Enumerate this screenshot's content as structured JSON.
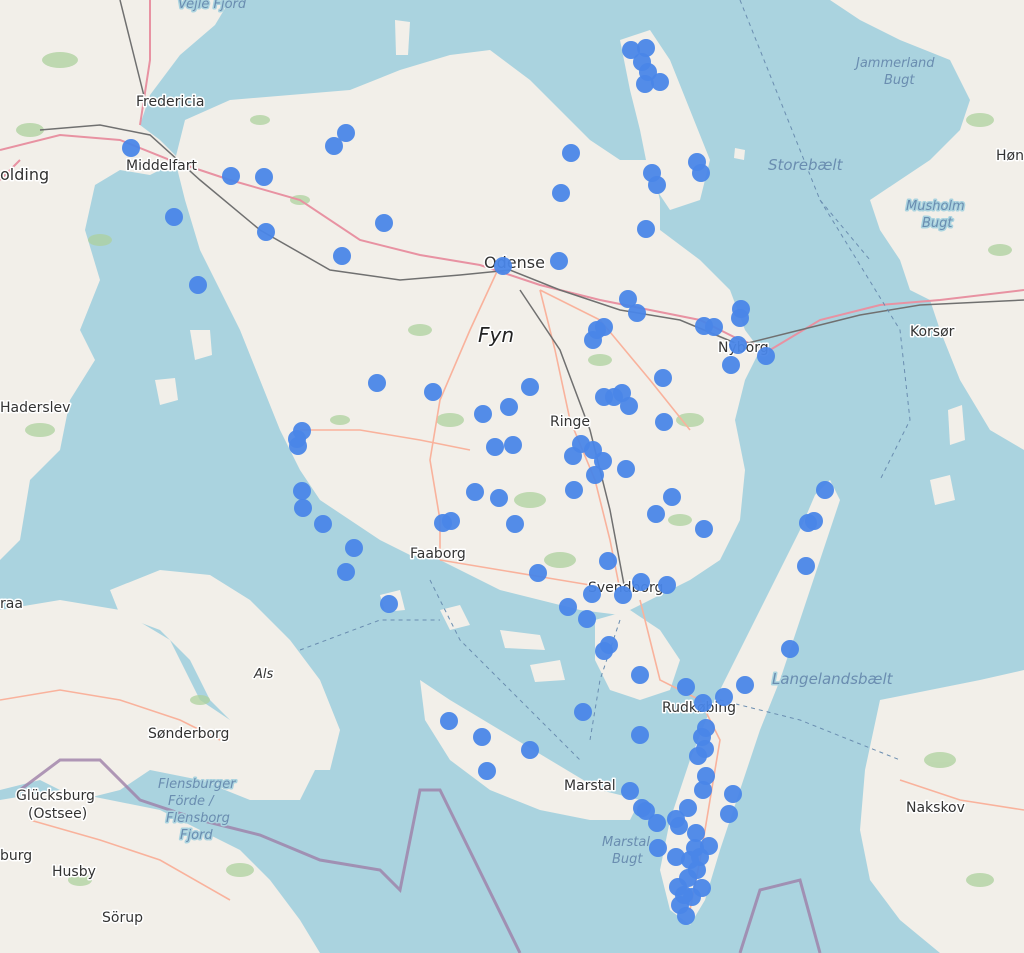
{
  "colors": {
    "sea": "#aad3df",
    "land": "#f2efe9",
    "forest": "#add19e",
    "road_primary": "#e892a2",
    "road_secondary": "#f9b29c",
    "rail": "#707070",
    "border": "#9e7fa8",
    "marker": "#4a86e8"
  },
  "labels": {
    "vejle_fjord": "Vejle Fjord",
    "fredericia": "Fredericia",
    "middelfart": "Middelfart",
    "kolding": "olding",
    "haderslev": "Haderslev",
    "odense": "Odense",
    "fyn": "Fyn",
    "ringe": "Ringe",
    "faaborg": "Faaborg",
    "svendborg": "Svendborg",
    "nyborg": "Nyborg",
    "rudkobing": "Rudkøbing",
    "marstal": "Marstal",
    "als": "Als",
    "sonderborg": "Sønderborg",
    "flensburger_1": "Flensburger",
    "flensburger_2": "Förde /",
    "flensburger_3": "Flensborg",
    "flensburger_4": "Fjord",
    "glucksburg_1": "Glücksburg",
    "glucksburg_2": "(Ostsee)",
    "husby": "Husby",
    "sorup": "Sörup",
    "burg": "burg",
    "raa": "raa",
    "jammerland_1": "Jammerland",
    "jammerland_2": "Bugt",
    "storebaelt": "Storebælt",
    "musholm_1": "Musholm",
    "musholm_2": "Bugt",
    "korsor": "Korsør",
    "hong": "Høn",
    "langelandsbaelt": "Langelandsbælt",
    "nakskov": "Nakskov",
    "marstal_bugt_1": "Marstal",
    "marstal_bugt_2": "Bugt"
  },
  "markers": {
    "count": 140,
    "color_name": "marker-blue"
  }
}
